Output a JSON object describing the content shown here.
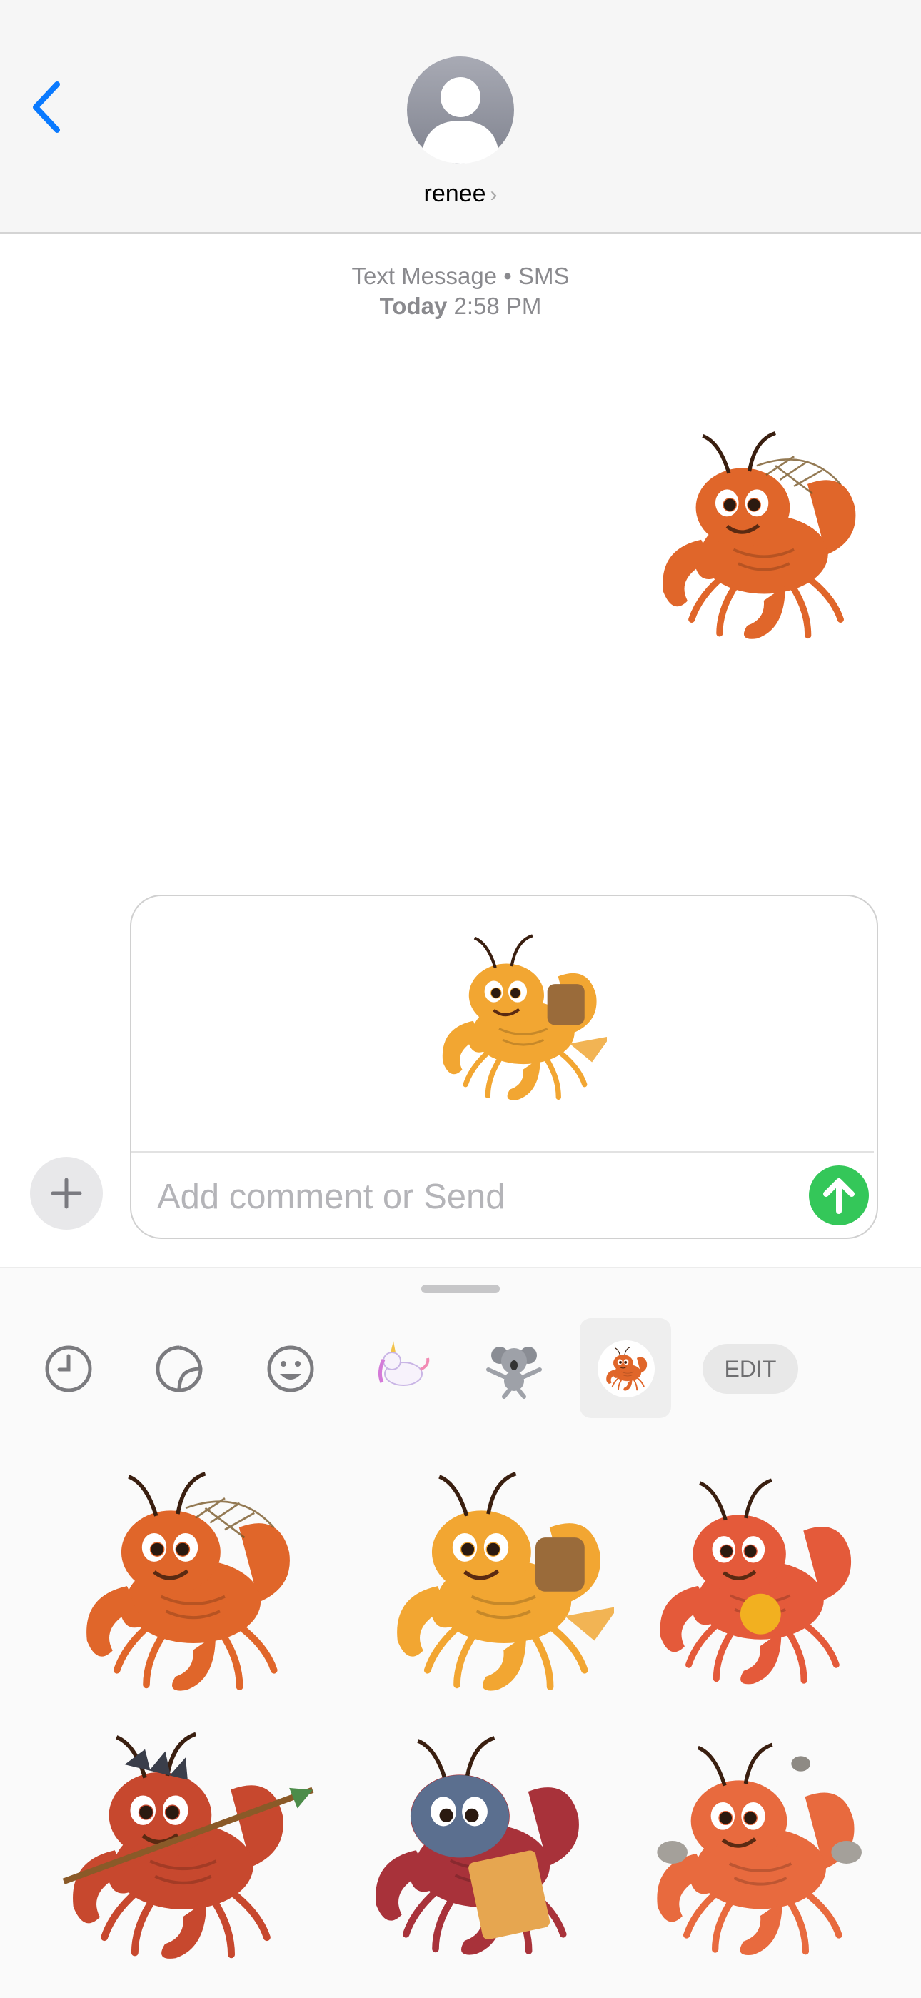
{
  "header": {
    "back_icon": "chevron-left-icon",
    "contact_name": "renee",
    "avatar": "person-placeholder-avatar"
  },
  "thread": {
    "service_label": "Text Message • SMS",
    "day": "Today",
    "time": "2:58 PM",
    "sent_sticker": "crab-with-net"
  },
  "composer": {
    "placeholder": "Add comment or Send",
    "pending_sticker": "crab-with-backpack-waving",
    "plus_icon": "plus-icon",
    "send_icon": "arrow-up-icon"
  },
  "drawer": {
    "tabs": [
      "recent-clock-icon",
      "stickers-peel-icon",
      "emoji-smiley-icon",
      "unicorn-pack",
      "koala-pack",
      "crab-pack"
    ],
    "edit_label": "EDIT",
    "stickers": [
      "crab-with-net",
      "crab-with-backpack",
      "crab-holding-orange",
      "crab-with-spear",
      "crab-reading-book",
      "crab-juggling-rocks"
    ]
  },
  "colors": {
    "accent": "#0a7aff",
    "send": "#34c759",
    "crab_orange": "#e0662a",
    "crab_yellow": "#f2a632",
    "crab_red": "#c4332b"
  }
}
